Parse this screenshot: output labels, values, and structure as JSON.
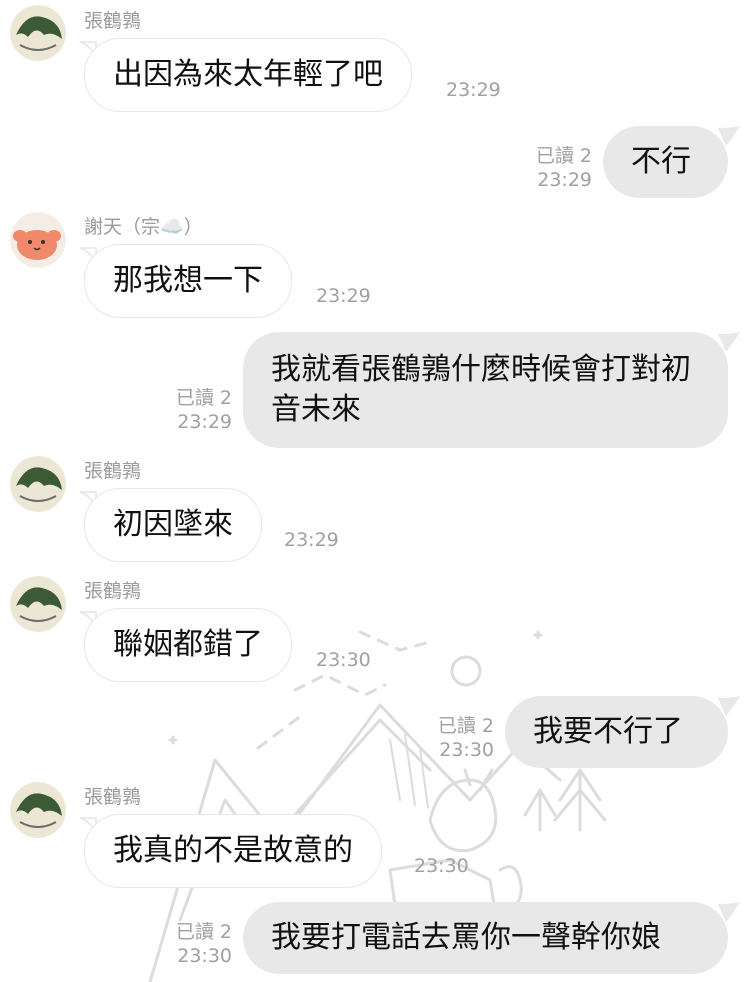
{
  "messages": [
    {
      "sender": "張鶴鶉",
      "text": "出因為來太年輕了吧",
      "time": "23:29"
    },
    {
      "read": "已讀 2",
      "time": "23:29",
      "text": "不行"
    },
    {
      "sender": "謝天（宗☁️）",
      "text": "那我想一下",
      "time": "23:29"
    },
    {
      "read": "已讀 2",
      "time": "23:29",
      "text": "我就看張鶴鶉什麼時候會打對初音未來"
    },
    {
      "sender": "張鶴鶉",
      "text": "初因墜來",
      "time": "23:29"
    },
    {
      "sender": "張鶴鶉",
      "text": "聯姻都錯了",
      "time": "23:30"
    },
    {
      "read": "已讀 2",
      "time": "23:30",
      "text": "我要不行了"
    },
    {
      "sender": "張鶴鶉",
      "text": "我真的不是故意的",
      "time": "23:30"
    },
    {
      "read": "已讀 2",
      "time": "23:30",
      "text": "我要打電話去罵你一聲幹你娘"
    }
  ],
  "colors": {
    "out_bubble": "#e8e8e8",
    "meta": "#a0a0a0"
  }
}
